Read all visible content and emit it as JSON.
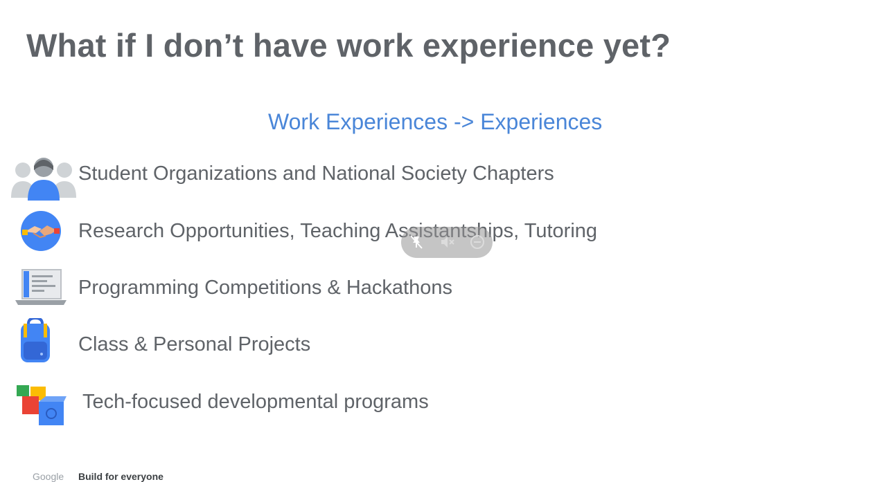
{
  "slide": {
    "title": "What if I don’t have work experience yet?",
    "subtitle": "Work Experiences -> Experiences",
    "items": [
      {
        "label": "Student Organizations and National Society Chapters",
        "icon": "people-group-icon"
      },
      {
        "label": "Research Opportunities, Teaching Assistantships, Tutoring",
        "icon": "handshake-icon"
      },
      {
        "label": "Programming Competitions & Hackathons",
        "icon": "laptop-icon"
      },
      {
        "label": "Class & Personal Projects",
        "icon": "backpack-icon"
      },
      {
        "label": "Tech-focused developmental programs",
        "icon": "building-blocks-icon"
      }
    ]
  },
  "footer": {
    "logo_text": "Google",
    "tagline": "Build for everyone"
  },
  "media_controls": {
    "buttons": [
      "pin-off-icon",
      "mute-icon",
      "minimize-icon"
    ]
  },
  "colors": {
    "title": "#5f6368",
    "subtitle": "#4a86d8",
    "google_blue": "#4285f4",
    "google_red": "#ea4335",
    "google_yellow": "#fbbc04",
    "google_green": "#34a853"
  }
}
